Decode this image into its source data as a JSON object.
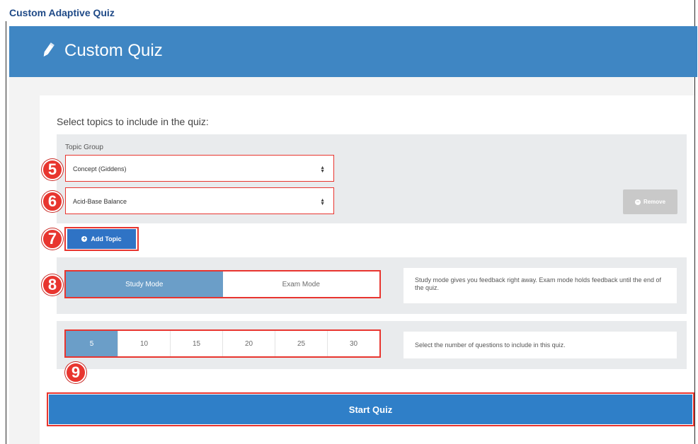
{
  "window": {
    "title": "Custom Adaptive Quiz"
  },
  "header": {
    "title": "Custom Quiz",
    "icon": "pencil-icon",
    "background": "#3f86c3"
  },
  "topics": {
    "prompt": "Select topics to include in the quiz:",
    "group_label": "Topic Group",
    "group_value": "Concept (Giddens)",
    "topic_value": "Acid-Base Balance",
    "remove_label": "Remove",
    "add_label": "Add Topic"
  },
  "mode": {
    "options": [
      "Study Mode",
      "Exam Mode"
    ],
    "selected": "Study Mode",
    "description": "Study mode gives you feedback right away. Exam mode holds feedback until the end of the quiz."
  },
  "question_count": {
    "options": [
      "5",
      "10",
      "15",
      "20",
      "25",
      "30"
    ],
    "selected": "5",
    "description": "Select the number of questions to include in this quiz."
  },
  "start_label": "Start Quiz",
  "callouts": [
    "5",
    "6",
    "7",
    "8",
    "9"
  ],
  "colors": {
    "accent": "#2f7fc8",
    "highlight": "#e8352f",
    "selected_segment": "#6b9ec8"
  }
}
